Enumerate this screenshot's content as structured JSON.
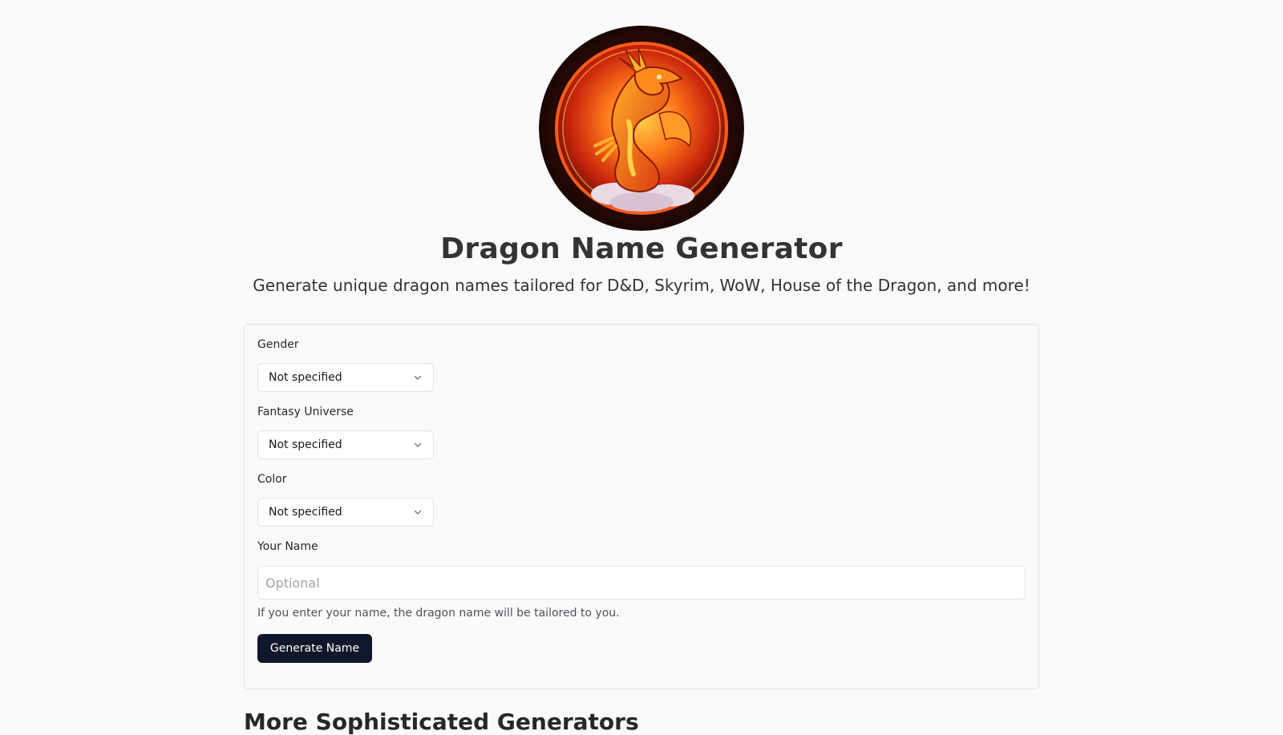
{
  "header": {
    "logo_icon": "dragon-emblem-icon",
    "title": "Dragon Name Generator",
    "subtitle": "Generate unique dragon names tailored for D&D, Skyrim, WoW, House of the Dragon, and more!"
  },
  "form": {
    "gender": {
      "label": "Gender",
      "value": "Not specified"
    },
    "universe": {
      "label": "Fantasy Universe",
      "value": "Not specified"
    },
    "color": {
      "label": "Color",
      "value": "Not specified"
    },
    "name": {
      "label": "Your Name",
      "placeholder": "Optional",
      "value": "",
      "helper": "If you enter your name, the dragon name will be tailored to you."
    },
    "submit_label": "Generate Name"
  },
  "next_section": {
    "heading": "More Sophisticated Generators"
  },
  "colors": {
    "background": "#fafafa",
    "button": "#0f172a",
    "border": "#e4e4e7",
    "text": "#333333"
  }
}
